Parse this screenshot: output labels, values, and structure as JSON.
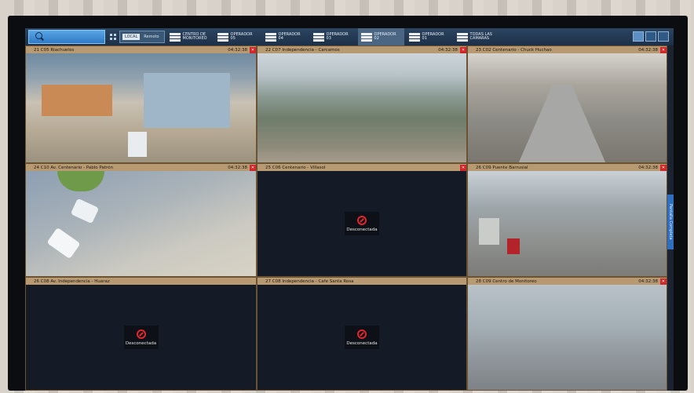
{
  "toolbar": {
    "search_placeholder": "",
    "chips": [
      "LOCAL",
      "Remoto"
    ],
    "tabs": [
      {
        "label": "CENTRO DE MONITOREO"
      },
      {
        "label": "OPERADOR 05"
      },
      {
        "label": "OPERADOR 04"
      },
      {
        "label": "OPERADOR 03"
      },
      {
        "label": "OPERADOR 02"
      },
      {
        "label": "OPERADOR 01"
      },
      {
        "label": "TODAS LAS CAMARAS"
      }
    ]
  },
  "cameras": [
    {
      "name": "21 C05 Riachuelos",
      "time": "04:32:38",
      "connected": true
    },
    {
      "name": "22 C07 Independencia - Carcamos",
      "time": "04:32:38",
      "connected": true
    },
    {
      "name": "23 C02 Centenario - Chuck Huchao",
      "time": "04:32:38",
      "connected": true
    },
    {
      "name": "24 C10 Av. Centenario - Pablo Patrón",
      "time": "04:32:38",
      "connected": true
    },
    {
      "name": "25 C06 Centenario - Villasol",
      "time": "",
      "connected": false,
      "status": "Desconectada"
    },
    {
      "name": "26 C09 Puente Barrusial",
      "time": "04:32:38",
      "connected": true
    },
    {
      "name": "26 C08 Av. Independencia - Huaraz",
      "time": "",
      "connected": false,
      "status": "Desconectada"
    },
    {
      "name": "27 C08 Independencia - Cafe Santa Rosa",
      "time": "",
      "connected": false,
      "status": "Desconectada"
    },
    {
      "name": "28 C09 Centro de Monitoreo",
      "time": "04:32:38",
      "connected": true
    }
  ],
  "side_tab": "Pantalla Completa"
}
